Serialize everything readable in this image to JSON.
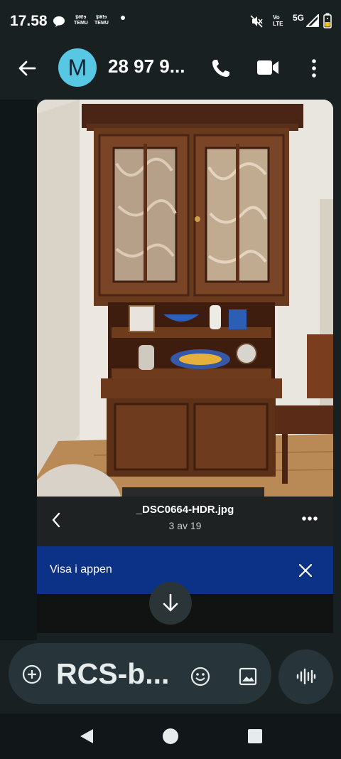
{
  "status_bar": {
    "time": "17.58",
    "app_badges": [
      {
        "line1": "इअ!ɘ",
        "line2": "TEMU"
      },
      {
        "line1": "इअ!ɘ",
        "line2": "TEMU"
      }
    ],
    "volte_line1": "Vo",
    "volte_line2": "LTE",
    "network": "5G",
    "icons": [
      "chat-bubble-icon",
      "mute-icon",
      "signal-icon",
      "battery-icon"
    ]
  },
  "header": {
    "avatar_letter": "M",
    "contact_name": "28 97 9...",
    "icons": [
      "back-arrow-icon",
      "phone-icon",
      "video-call-icon",
      "more-vert-icon"
    ]
  },
  "attachment": {
    "file_name": "_DSC0664-HDR.jpg",
    "counter": "3 av 19",
    "image_subject": "photo of a wooden display cabinet",
    "icons": [
      "chevron-left-icon",
      "more-horiz-icon"
    ]
  },
  "app_banner": {
    "label": "Visa i appen",
    "color": "#0c3287",
    "icons": [
      "close-icon"
    ]
  },
  "download": {
    "icon": "download-arrow-icon"
  },
  "composer": {
    "text": "RCS-b...",
    "icons": [
      "add-circle-icon",
      "emoji-icon",
      "image-icon",
      "voice-waveform-icon"
    ]
  },
  "nav_bar": {
    "icons": [
      "nav-back-icon",
      "nav-home-icon",
      "nav-recents-icon"
    ]
  }
}
